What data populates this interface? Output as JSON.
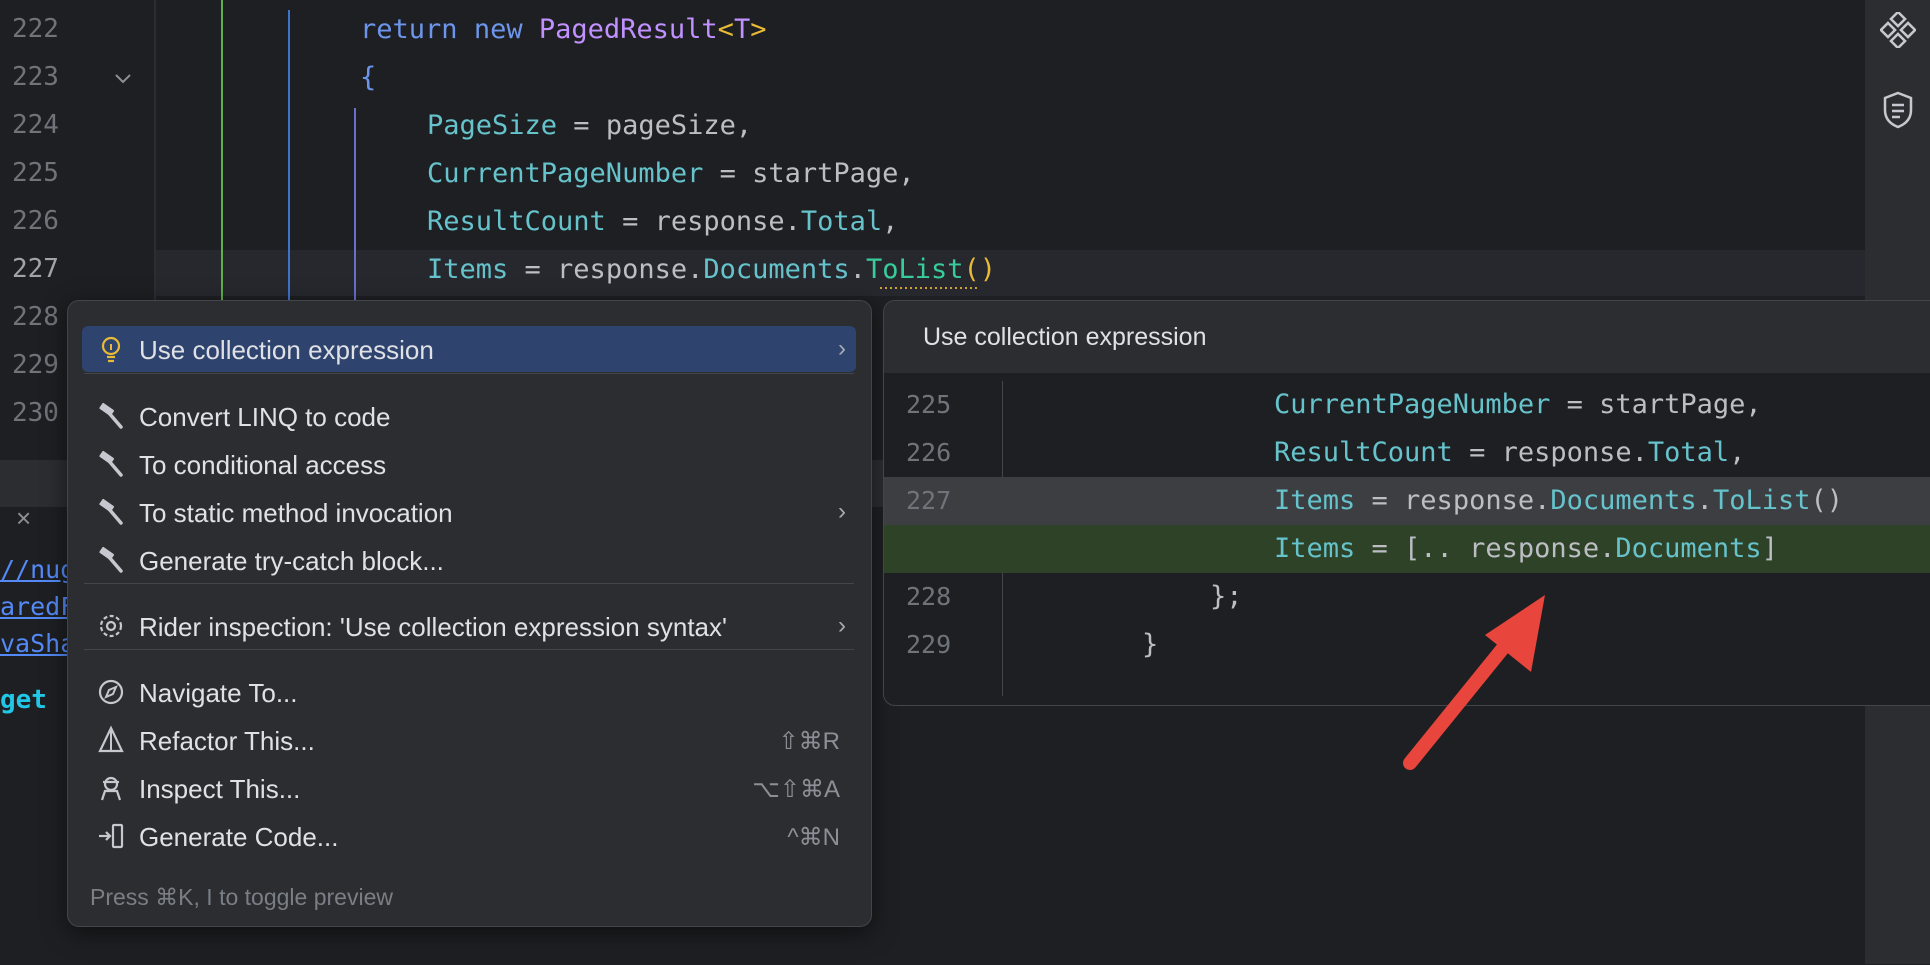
{
  "editor": {
    "line_numbers": [
      "222",
      "223",
      "224",
      "225",
      "226",
      "227",
      "228",
      "229",
      "230"
    ],
    "lines": [
      {
        "n": "222",
        "tokens": [
          {
            "t": "return",
            "c": "kw"
          },
          {
            "t": " "
          },
          {
            "t": "new",
            "c": "kw"
          },
          {
            "t": " "
          },
          {
            "t": "PagedResult",
            "c": "tp"
          },
          {
            "t": "<",
            "c": "gen"
          },
          {
            "t": "T",
            "c": "tp"
          },
          {
            "t": ">",
            "c": "gen"
          }
        ]
      },
      {
        "n": "223",
        "tokens": [
          {
            "t": "{",
            "c": "kw"
          }
        ]
      },
      {
        "n": "224",
        "tokens": [
          {
            "t": "PageSize",
            "c": "pr"
          },
          {
            "t": " = pageSize,"
          }
        ]
      },
      {
        "n": "225",
        "tokens": [
          {
            "t": "CurrentPageNumber",
            "c": "pr"
          },
          {
            "t": " = startPage,"
          }
        ]
      },
      {
        "n": "226",
        "tokens": [
          {
            "t": "ResultCount",
            "c": "pr"
          },
          {
            "t": " = response."
          },
          {
            "t": "Total",
            "c": "pr"
          },
          {
            "t": ","
          }
        ]
      },
      {
        "n": "227",
        "tokens": [
          {
            "t": "Items",
            "c": "pr"
          },
          {
            "t": " = response."
          },
          {
            "t": "Documents",
            "c": "pr"
          },
          {
            "t": "."
          },
          {
            "t": "ToList",
            "c": "fn"
          },
          {
            "t": "()",
            "c": "par"
          }
        ]
      }
    ]
  },
  "lower_panel": {
    "close_symbol": "×",
    "links": [
      "//nug",
      "aredF",
      "vaSha"
    ],
    "get_text": "get"
  },
  "context_menu": {
    "items": [
      {
        "label": "Use collection expression",
        "icon": "lightbulb-icon",
        "submenu": true,
        "selected": true
      },
      {
        "label": "Convert LINQ to code",
        "icon": "hammer-icon"
      },
      {
        "label": "To conditional access",
        "icon": "hammer-icon"
      },
      {
        "label": "To static method invocation",
        "icon": "hammer-icon",
        "submenu": true
      },
      {
        "label": "Generate try-catch block...",
        "icon": "hammer-icon"
      },
      {
        "label": "Rider inspection: 'Use collection expression syntax'",
        "icon": "gear-icon",
        "submenu": true
      },
      {
        "label": "Navigate To...",
        "icon": "compass-icon"
      },
      {
        "label": "Refactor This...",
        "icon": "refactor-icon",
        "shortcut": "⇧⌘R"
      },
      {
        "label": "Inspect This...",
        "icon": "inspect-icon",
        "shortcut": "⌥⇧⌘A"
      },
      {
        "label": "Generate Code...",
        "icon": "generate-icon",
        "shortcut": "^⌘N"
      }
    ],
    "chevron": "›",
    "footer": "Press ⌘K, I to toggle preview"
  },
  "preview": {
    "title": "Use collection expression",
    "lines": [
      {
        "n": "225",
        "tokens": [
          {
            "t": "CurrentPageNumber",
            "c": "pr"
          },
          {
            "t": " = startPage,"
          }
        ]
      },
      {
        "n": "226",
        "tokens": [
          {
            "t": "ResultCount",
            "c": "pr"
          },
          {
            "t": " = response."
          },
          {
            "t": "Total",
            "c": "pr"
          },
          {
            "t": ","
          }
        ]
      },
      {
        "n": "227",
        "tokens": [
          {
            "t": "Items",
            "c": "pr"
          },
          {
            "t": " = response."
          },
          {
            "t": "Documents",
            "c": "pr"
          },
          {
            "t": "."
          },
          {
            "t": "ToList",
            "c": "pr"
          },
          {
            "t": "()"
          }
        ]
      },
      {
        "n": "",
        "tokens": [
          {
            "t": "Items",
            "c": "pr"
          },
          {
            "t": " = [.. response."
          },
          {
            "t": "Documents",
            "c": "pr"
          },
          {
            "t": "]"
          }
        ]
      },
      {
        "n": "228",
        "tokens": [
          {
            "t": "};"
          }
        ]
      },
      {
        "n": "229",
        "tokens": [
          {
            "t": "}"
          }
        ]
      }
    ]
  },
  "colors": {
    "removed_line": "#3c3e42",
    "added_line": "#2d4227",
    "arrow": "#e8453c",
    "selected_item": "#2e436e"
  }
}
